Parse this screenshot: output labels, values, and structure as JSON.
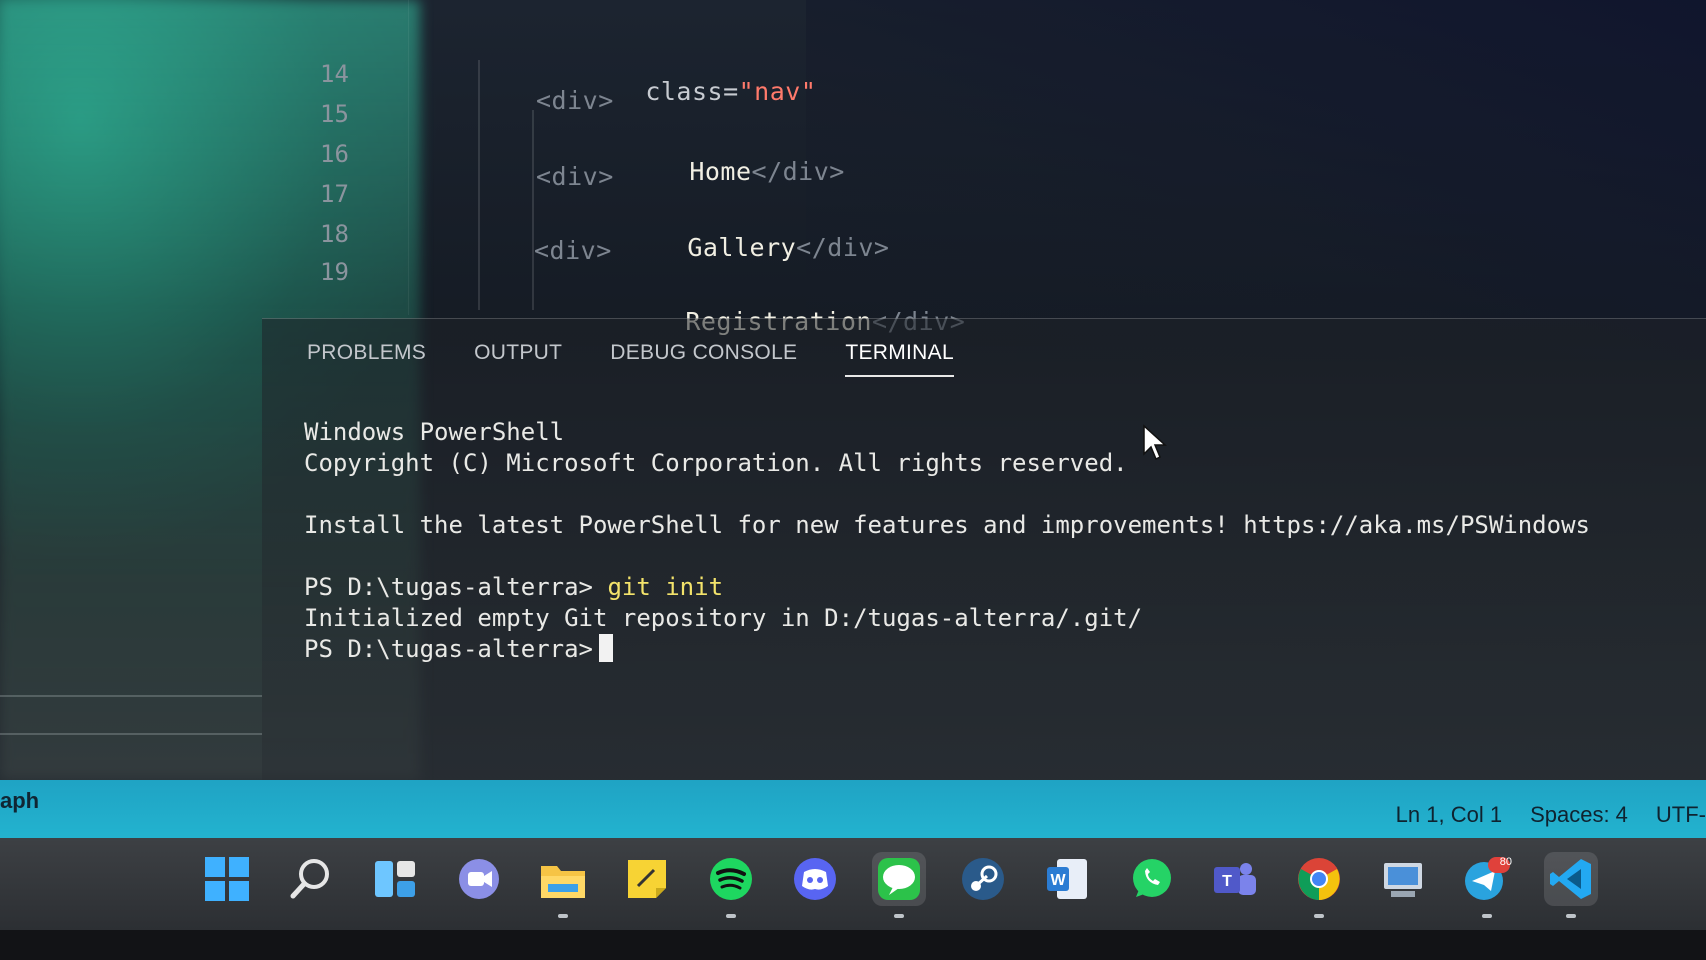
{
  "editor": {
    "lines": [
      {
        "number": "14",
        "code": "class=\"nav\""
      },
      {
        "number": "15",
        "code": "<div>"
      },
      {
        "number": "16",
        "code": "Home</div>"
      },
      {
        "number": "17",
        "code": "<div>"
      },
      {
        "number": "18",
        "code": "Gallery</div>"
      },
      {
        "number": "19",
        "code": "Registration</div>"
      }
    ],
    "fragments": {
      "attr_name": "class=",
      "attr_value": "\"nav\"",
      "open_div": "<div>",
      "home": "Home",
      "gallery": "Gallery",
      "registration": "Registration",
      "close_div": "</div>"
    }
  },
  "panel": {
    "tabs": [
      {
        "label": "PROBLEMS",
        "active": false
      },
      {
        "label": "OUTPUT",
        "active": false
      },
      {
        "label": "DEBUG CONSOLE",
        "active": false
      },
      {
        "label": "TERMINAL",
        "active": true
      }
    ]
  },
  "terminal": {
    "line1": "Windows PowerShell",
    "line2": "Copyright (C) Microsoft Corporation. All rights reserved.",
    "line3": "Install the latest PowerShell for new features and improvements! https://aka.ms/PSWindows",
    "prompt": "PS D:\\tugas-alterra>",
    "command": "git init",
    "output": "Initialized empty Git repository in D:/tugas-alterra/.git/",
    "prompt2": "PS D:\\tugas-alterra>"
  },
  "statusbar": {
    "left_text": "aph",
    "position": "Ln 1, Col 1",
    "spaces": "Spaces: 4",
    "encoding": "UTF-"
  },
  "taskbar": {
    "icons": [
      "windows-start-icon",
      "search-icon",
      "widgets-icon",
      "chat-icon",
      "file-explorer-icon",
      "sticky-notes-icon",
      "spotify-icon",
      "discord-icon",
      "line-icon",
      "steam-icon",
      "word-icon",
      "whatsapp-icon",
      "teams-icon",
      "chrome-icon",
      "control-panel-icon",
      "telegram-icon",
      "vscode-icon"
    ],
    "telegram_badge": "80"
  },
  "colors": {
    "statusbar": "#23b3cf",
    "terminal_text": "#e9e9e6",
    "command": "#f3e36b",
    "string": "#ff7a6b"
  }
}
